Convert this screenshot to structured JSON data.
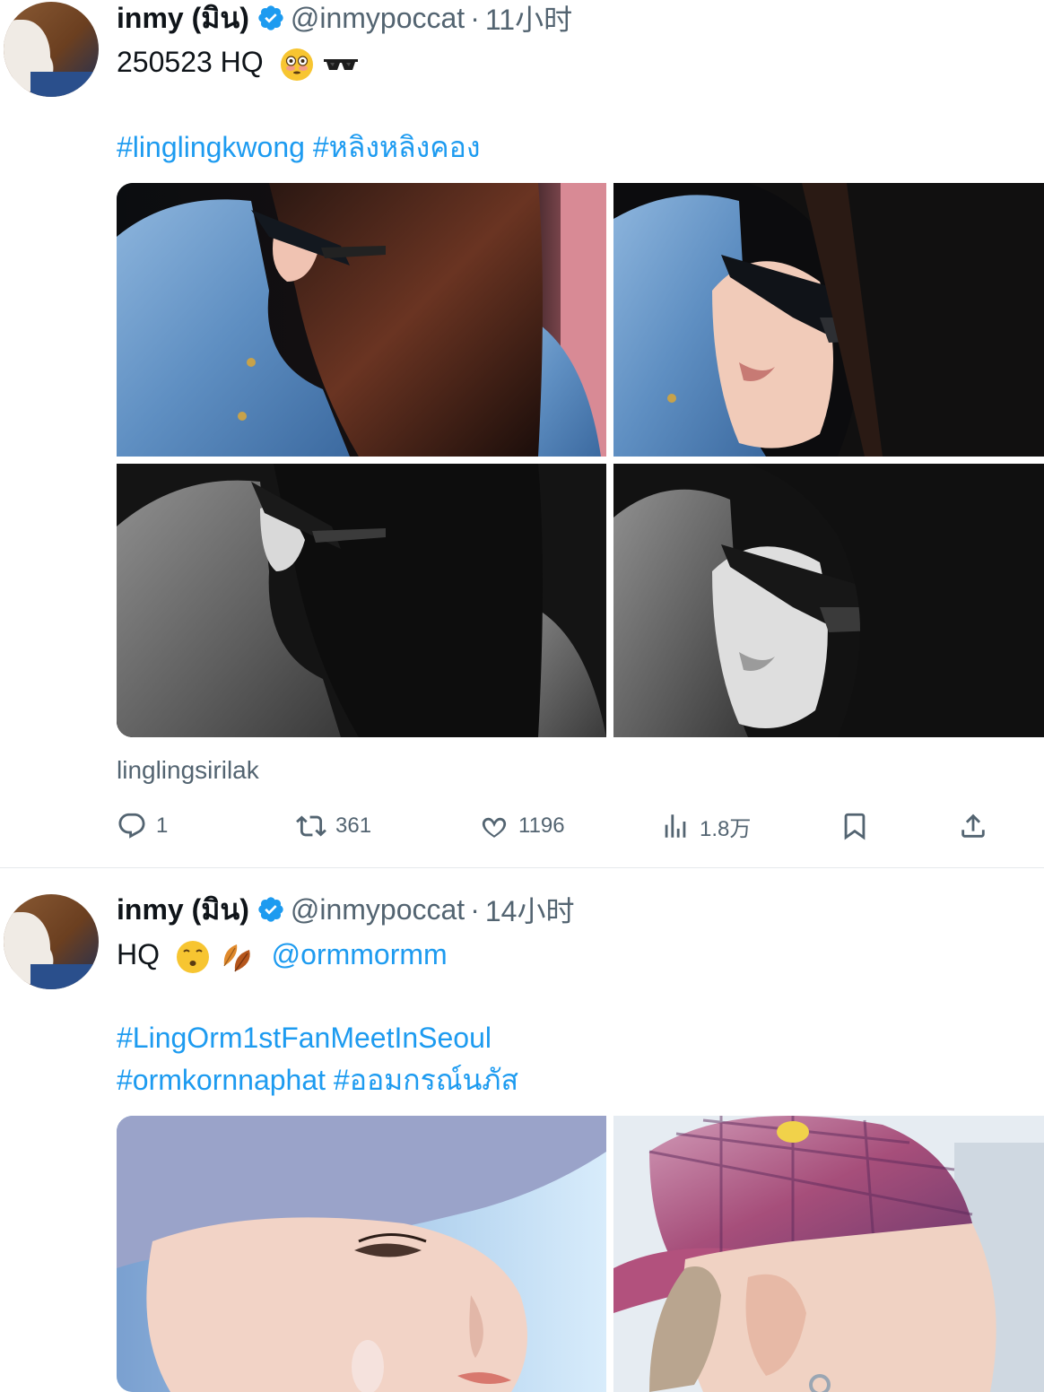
{
  "tweets": [
    {
      "display_name": "inmy (มิน)",
      "handle": "@inmypoccat",
      "separator": "·",
      "time": "11小时",
      "text_line1": "250523 HQ",
      "hashtags": "#linglingkwong #หลิงหลิงคอง",
      "media_credit": "linglingsirilak",
      "stats": {
        "replies": "1",
        "retweets": "361",
        "likes": "1196",
        "views": "1.8万"
      }
    },
    {
      "display_name": "inmy (มิน)",
      "handle": "@inmypoccat",
      "separator": "·",
      "time": "14小时",
      "text_line1": "HQ",
      "mention": "@ormmormm",
      "hashtag_line1": "#LingOrm1stFanMeetInSeoul",
      "hashtag_line2": "#ormkornnaphat #ออมกรณ์นภัส"
    }
  ],
  "icons": {
    "verified": "verified-badge-icon",
    "reply": "reply-icon",
    "retweet": "retweet-icon",
    "like": "heart-icon",
    "views": "views-chart-icon",
    "bookmark": "bookmark-icon",
    "share": "share-icon"
  },
  "colors": {
    "link": "#1d9bf0",
    "secondary_text": "#536471",
    "primary_text": "#0f1419",
    "divider": "#e6e9ec"
  }
}
